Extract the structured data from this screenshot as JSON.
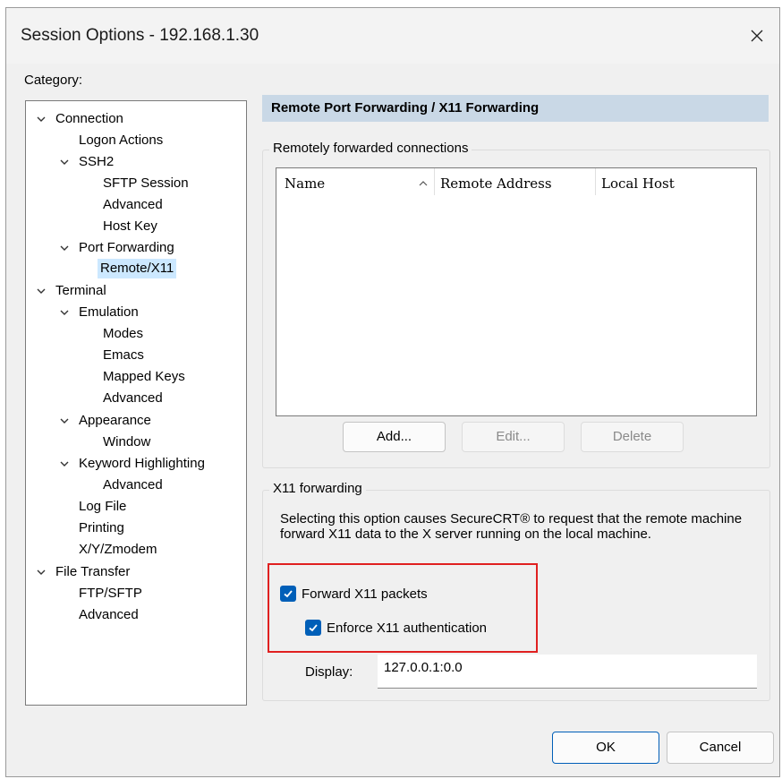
{
  "window": {
    "title": "Session Options - 192.168.1.30",
    "close_icon": "close-icon"
  },
  "category": {
    "label": "Category:",
    "items": [
      {
        "label": "Connection",
        "expanded": true
      },
      {
        "label": "Logon Actions"
      },
      {
        "label": "SSH2",
        "expanded": true
      },
      {
        "label": "SFTP Session"
      },
      {
        "label": "Advanced"
      },
      {
        "label": "Host Key"
      },
      {
        "label": "Port Forwarding",
        "expanded": true
      },
      {
        "label": "Remote/X11",
        "selected": true
      },
      {
        "label": "Terminal",
        "expanded": true
      },
      {
        "label": "Emulation",
        "expanded": true
      },
      {
        "label": "Modes"
      },
      {
        "label": "Emacs"
      },
      {
        "label": "Mapped Keys"
      },
      {
        "label": "Advanced"
      },
      {
        "label": "Appearance",
        "expanded": true
      },
      {
        "label": "Window"
      },
      {
        "label": "Keyword Highlighting",
        "expanded": true
      },
      {
        "label": "Advanced"
      },
      {
        "label": "Log File"
      },
      {
        "label": "Printing"
      },
      {
        "label": "X/Y/Zmodem"
      },
      {
        "label": "File Transfer",
        "expanded": true
      },
      {
        "label": "FTP/SFTP"
      },
      {
        "label": "Advanced"
      }
    ]
  },
  "panel": {
    "header": "Remote Port Forwarding / X11 Forwarding",
    "remote_group": {
      "label": "Remotely forwarded connections",
      "columns": [
        "Name",
        "Remote Address",
        "Local Host"
      ],
      "add_label": "Add...",
      "edit_label": "Edit...",
      "delete_label": "Delete"
    },
    "x11_group": {
      "label": "X11 forwarding",
      "description": "Selecting this option causes SecureCRT® to request that the remote machine forward X11 data to the X server running on the local machine.",
      "forward_label": "Forward X11 packets",
      "forward_checked": true,
      "enforce_label": "Enforce X11 authentication",
      "enforce_checked": true,
      "display_label": "Display:",
      "display_value": "127.0.0.1:0.0"
    }
  },
  "footer": {
    "ok_label": "OK",
    "cancel_label": "Cancel"
  },
  "colors": {
    "accent": "#005fb8",
    "header_bg": "#c9d8e6",
    "selection_bg": "#cce8ff",
    "highlight_box": "#e02020"
  }
}
